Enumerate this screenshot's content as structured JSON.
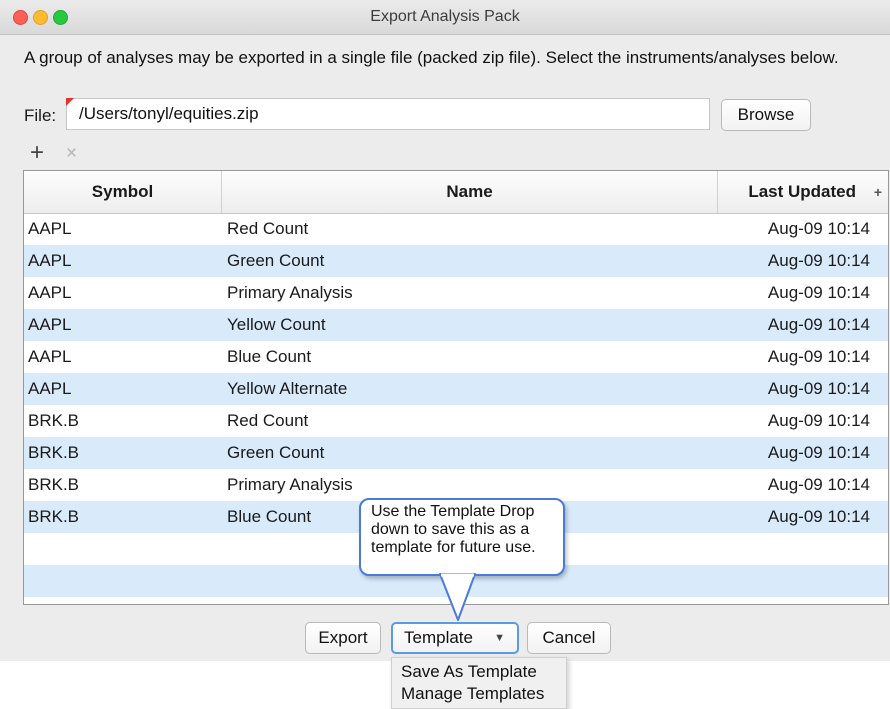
{
  "window": {
    "title": "Export Analysis Pack"
  },
  "description": "A group of analyses may be exported in a single file (packed zip file). Select the instruments/analyses below.",
  "file": {
    "label": "File:",
    "value": "/Users/tonyl/equities.zip",
    "browse_label": "Browse"
  },
  "toolbar": {
    "add_symbol": "+",
    "remove_symbol": "×"
  },
  "table": {
    "columns": [
      "Symbol",
      "Name",
      "Last Updated"
    ],
    "add_column_symbol": "+",
    "rows": [
      {
        "symbol": "AAPL",
        "name": "Red Count",
        "updated": "Aug-09 10:14"
      },
      {
        "symbol": "AAPL",
        "name": "Green Count",
        "updated": "Aug-09 10:14"
      },
      {
        "symbol": "AAPL",
        "name": "Primary Analysis",
        "updated": "Aug-09 10:14"
      },
      {
        "symbol": "AAPL",
        "name": "Yellow Count",
        "updated": "Aug-09 10:14"
      },
      {
        "symbol": "AAPL",
        "name": "Blue Count",
        "updated": "Aug-09 10:14"
      },
      {
        "symbol": "AAPL",
        "name": "Yellow Alternate",
        "updated": "Aug-09 10:14"
      },
      {
        "symbol": "BRK.B",
        "name": "Red Count",
        "updated": "Aug-09 10:14"
      },
      {
        "symbol": "BRK.B",
        "name": "Green Count",
        "updated": "Aug-09 10:14"
      },
      {
        "symbol": "BRK.B",
        "name": "Primary Analysis",
        "updated": "Aug-09 10:14"
      },
      {
        "symbol": "BRK.B",
        "name": "Blue Count",
        "updated": "Aug-09 10:14"
      },
      {
        "symbol": "",
        "name": "",
        "updated": ""
      },
      {
        "symbol": "",
        "name": "",
        "updated": ""
      }
    ]
  },
  "buttons": {
    "export": "Export",
    "template": "Template",
    "cancel": "Cancel"
  },
  "callout": "Use the Template Drop down to save this as a template for future use.",
  "template_menu": {
    "items": [
      "Save As Template",
      "Manage Templates"
    ]
  },
  "colors": {
    "row_alt": "#d9ebfb",
    "focus": "#5a9be6",
    "callout_border": "#4a7bd8"
  }
}
